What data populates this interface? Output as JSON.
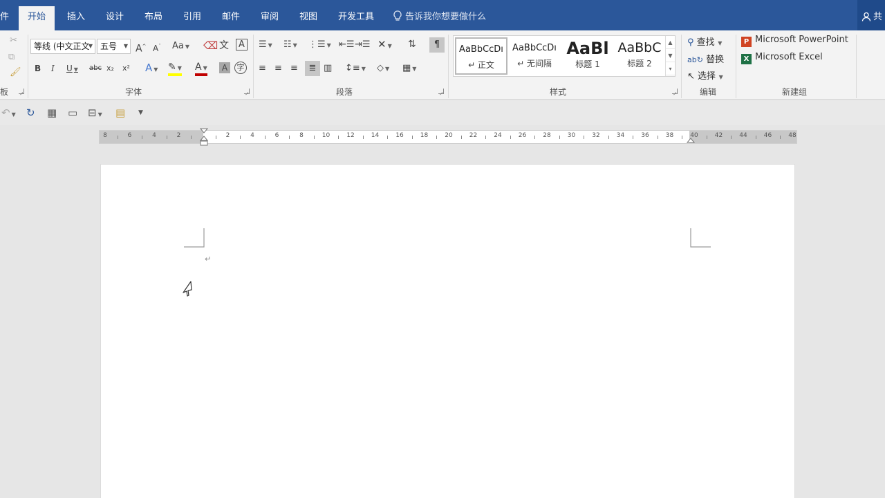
{
  "tabs": [
    {
      "label": "件",
      "active": false
    },
    {
      "label": "开始",
      "active": true
    },
    {
      "label": "插入",
      "active": false
    },
    {
      "label": "设计",
      "active": false
    },
    {
      "label": "布局",
      "active": false
    },
    {
      "label": "引用",
      "active": false
    },
    {
      "label": "邮件",
      "active": false
    },
    {
      "label": "审阅",
      "active": false
    },
    {
      "label": "视图",
      "active": false
    },
    {
      "label": "开发工具",
      "active": false
    }
  ],
  "tell_me": "告诉我你想要做什么",
  "share": "共",
  "font": {
    "group_label": "字体",
    "name": "等线 (中文正文",
    "size": "五号",
    "grow": "A",
    "shrink": "A",
    "case": "Aa",
    "bold": "B",
    "italic": "I",
    "underline": "U",
    "strike": "abc",
    "subscript": "x₂",
    "superscript": "x²",
    "color_a": "A",
    "shade_a": "A",
    "boxed_a": "A",
    "phonetic": "文",
    "circle": "字"
  },
  "clipboard": {
    "group_label": "板"
  },
  "paragraph": {
    "group_label": "段落"
  },
  "styles": {
    "group_label": "样式",
    "items": [
      {
        "sample": "AaBbCcDı",
        "name": "↵ 正文",
        "selected": true
      },
      {
        "sample": "AaBbCcDı",
        "name": "↵ 无间隔",
        "selected": false
      },
      {
        "sample": "AaBl",
        "name": "标题 1",
        "selected": false
      },
      {
        "sample": "AaBbC",
        "name": "标题 2",
        "selected": false
      }
    ]
  },
  "editing": {
    "group_label": "编辑",
    "find": "查找",
    "replace": "替换",
    "select": "选择"
  },
  "new_group": {
    "group_label": "新建组",
    "powerpoint": "Microsoft PowerPoint",
    "excel": "Microsoft Excel"
  },
  "ruler_numbers": [
    "8",
    "6",
    "4",
    "2",
    "",
    "2",
    "4",
    "6",
    "8",
    "10",
    "12",
    "14",
    "16",
    "18",
    "20",
    "22",
    "24",
    "26",
    "28",
    "30",
    "32",
    "34",
    "36",
    "38",
    "40",
    "42",
    "44",
    "46",
    "48"
  ],
  "document": {
    "paragraph_mark": "↵"
  },
  "colors": {
    "accent": "#2b579a",
    "ribbon": "#f3f3f3",
    "page": "#ffffff",
    "highlight": "#ffff00",
    "font_color": "#c00000"
  }
}
